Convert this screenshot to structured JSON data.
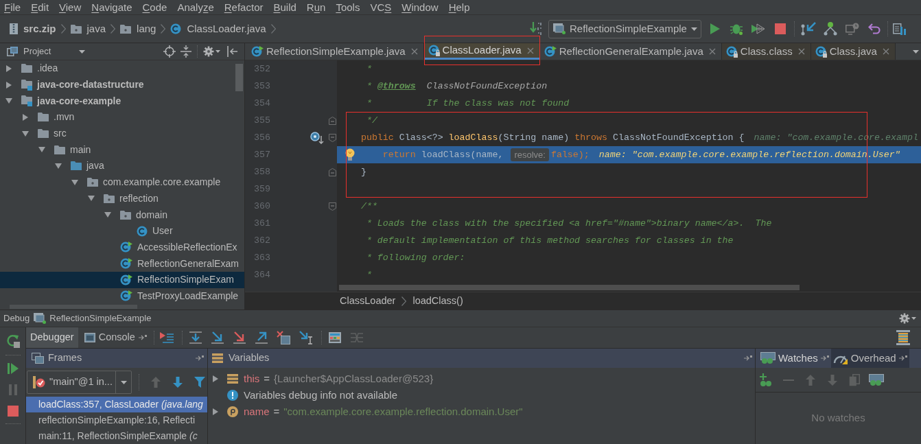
{
  "menu_bar": [
    {
      "key": "F",
      "post": "ile"
    },
    {
      "key": "E",
      "post": "dit"
    },
    {
      "key": "V",
      "post": "iew"
    },
    {
      "key": "N",
      "post": "avigate"
    },
    {
      "key": "C",
      "post": "ode"
    },
    {
      "pre": "Analy",
      "key": "z",
      "post": "e"
    },
    {
      "key": "R",
      "post": "efactor"
    },
    {
      "key": "B",
      "post": "uild"
    },
    {
      "pre": "R",
      "key": "u",
      "post": "n"
    },
    {
      "key": "T",
      "post": "ools"
    },
    {
      "pre": "VC",
      "key": "S"
    },
    {
      "key": "W",
      "post": "indow"
    },
    {
      "key": "H",
      "post": "elp"
    }
  ],
  "nav_bar": {
    "breadcrumbs": [
      {
        "label": "src.zip",
        "kind": "archive"
      },
      {
        "label": "java",
        "kind": "package"
      },
      {
        "label": "lang",
        "kind": "package"
      },
      {
        "label": "ClassLoader.java",
        "kind": "class"
      }
    ],
    "run_configuration": "ReflectionSimpleExample"
  },
  "project_panel": {
    "title": "Project",
    "tree": [
      {
        "label": ".idea",
        "kind": "folder",
        "expanded": false,
        "selected": false
      },
      {
        "label": "java-core-datastructure",
        "kind": "module",
        "expanded": false,
        "selected": false
      },
      {
        "label": "java-core-example",
        "kind": "module",
        "expanded": true,
        "selected": false,
        "children": [
          {
            "label": ".mvn",
            "kind": "folder",
            "expanded": false,
            "selected": false
          },
          {
            "label": "src",
            "kind": "folder",
            "expanded": true,
            "selected": false,
            "children": [
              {
                "label": "main",
                "kind": "folder",
                "expanded": true,
                "selected": false,
                "children": [
                  {
                    "label": "java",
                    "kind": "source-folder",
                    "expanded": true,
                    "selected": false,
                    "children": [
                      {
                        "label": "com.example.core.example",
                        "kind": "package",
                        "expanded": true,
                        "selected": false,
                        "children": [
                          {
                            "label": "reflection",
                            "kind": "package",
                            "expanded": true,
                            "selected": false,
                            "children": [
                              {
                                "label": "domain",
                                "kind": "package",
                                "expanded": true,
                                "selected": false,
                                "children": [
                                  {
                                    "label": "User",
                                    "kind": "class",
                                    "selected": false
                                  }
                                ]
                              },
                              {
                                "label": "AccessibleReflectionEx",
                                "kind": "runnable",
                                "selected": false
                              },
                              {
                                "label": "ReflectionGeneralExam",
                                "kind": "runnable",
                                "selected": false
                              },
                              {
                                "label": "ReflectionSimpleExam",
                                "kind": "runnable",
                                "selected": true
                              },
                              {
                                "label": "TestProxyLoadExample",
                                "kind": "runnable",
                                "selected": false
                              }
                            ]
                          }
                        ]
                      }
                    ]
                  }
                ]
              }
            ]
          }
        ]
      }
    ]
  },
  "editor": {
    "tabs": [
      {
        "label": "ReflectionSimpleExample.java",
        "kind": "runnable",
        "selected": false,
        "boxed": false
      },
      {
        "label": "ClassLoader.java",
        "kind": "library",
        "selected": true,
        "boxed": true
      },
      {
        "label": "ReflectionGeneralExample.java",
        "kind": "runnable",
        "selected": false,
        "boxed": false
      },
      {
        "label": "Class.class",
        "kind": "library",
        "selected": false,
        "boxed": false
      },
      {
        "label": "Class.java",
        "kind": "library",
        "selected": false,
        "boxed": false
      }
    ],
    "lines": [
      {
        "number": "352",
        "current": false,
        "boxed": false,
        "tokens": [
          {
            "text": "     *",
            "kind": "comment"
          }
        ]
      },
      {
        "number": "353",
        "current": false,
        "boxed": false,
        "tokens": [
          {
            "text": "     * ",
            "kind": "comment"
          },
          {
            "text": "@throws",
            "kind": "doc-tag"
          },
          {
            "text": "  ClassNotFoundException",
            "kind": "doc-value"
          }
        ]
      },
      {
        "number": "354",
        "current": false,
        "boxed": false,
        "tokens": [
          {
            "text": "     *          If the class was not found",
            "kind": "comment"
          }
        ]
      },
      {
        "number": "355",
        "current": false,
        "boxed": true,
        "markers": [
          {
            "kind": "fold-end"
          }
        ],
        "tokens": [
          {
            "text": "     */",
            "kind": "comment"
          }
        ]
      },
      {
        "number": "356",
        "current": false,
        "boxed": true,
        "markers": [
          {
            "kind": "overridden"
          },
          {
            "kind": "fold-start"
          }
        ],
        "tokens": [
          {
            "text": "    public",
            "kind": "keyword"
          },
          {
            "text": " Class<?> ",
            "kind": "plain"
          },
          {
            "text": "loadClass",
            "kind": "method"
          },
          {
            "text": "(String name) ",
            "kind": "plain"
          },
          {
            "text": "throws",
            "kind": "keyword"
          },
          {
            "text": " ClassNotFoundException {",
            "kind": "plain"
          },
          {
            "text": "name: \"com.example.core.exampl",
            "kind": "inline-value"
          }
        ]
      },
      {
        "number": "357",
        "current": true,
        "boxed": true,
        "markers": [
          {
            "kind": "bulb"
          }
        ],
        "tokens": [
          {
            "text": "        return",
            "kind": "keyword"
          },
          {
            "text": " loadClass(name, ",
            "kind": "plain"
          },
          {
            "text": "resolve:",
            "kind": "param-hint"
          },
          {
            "text": "false",
            "kind": "keyword"
          },
          {
            "text": ");",
            "kind": "keyword"
          },
          {
            "text": "name: \"com.example.core.example.reflection.domain.User\"",
            "kind": "inline-value"
          }
        ]
      },
      {
        "number": "358",
        "current": false,
        "boxed": true,
        "markers": [
          {
            "kind": "fold-end"
          }
        ],
        "tokens": [
          {
            "text": "    }",
            "kind": "plain"
          }
        ]
      },
      {
        "number": "359",
        "current": false,
        "boxed": true
      },
      {
        "number": "360",
        "current": false,
        "boxed": false,
        "markers": [
          {
            "kind": "fold-start"
          }
        ],
        "tokens": [
          {
            "text": "    /**",
            "kind": "comment"
          }
        ]
      },
      {
        "number": "361",
        "current": false,
        "boxed": false,
        "tokens": [
          {
            "text": "     * Loads the class with the specified <a href=\"#name\">binary name</a>.  The",
            "kind": "comment"
          }
        ]
      },
      {
        "number": "362",
        "current": false,
        "boxed": false,
        "tokens": [
          {
            "text": "     * default implementation of this method searches for classes in the",
            "kind": "comment"
          }
        ]
      },
      {
        "number": "363",
        "current": false,
        "boxed": false,
        "tokens": [
          {
            "text": "     * following order:",
            "kind": "comment"
          }
        ]
      },
      {
        "number": "364",
        "current": false,
        "boxed": false,
        "tokens": [
          {
            "text": "     *",
            "kind": "comment"
          }
        ]
      }
    ],
    "breadcrumbs": [
      "ClassLoader",
      "loadClass()"
    ]
  },
  "debug_window": {
    "title": "Debug",
    "session": "ReflectionSimpleExample",
    "tabs": [
      {
        "label": "Debugger",
        "selected": true
      },
      {
        "label": "Console",
        "selected": false
      }
    ],
    "frames": {
      "title": "Frames",
      "thread": "\"main\"@1 in...",
      "items": [
        {
          "location": "loadClass:357, ClassLoader",
          "package": "(java.lang",
          "selected": true
        },
        {
          "location": "reflectionSimpleExample:16, Reflecti",
          "selected": false
        },
        {
          "location": "main:11, ReflectionSimpleExample",
          "package": "(c",
          "selected": false
        }
      ]
    },
    "variables": {
      "title": "Variables",
      "items": [
        {
          "kind": "object",
          "name": "this",
          "operator": "=",
          "value": "{Launcher$AppClassLoader@523}",
          "expanded": false
        },
        {
          "kind": "info",
          "text": "Variables debug info not available"
        },
        {
          "kind": "parameter",
          "name": "name",
          "operator": "=",
          "value": "\"com.example.core.example.reflection.domain.User\"",
          "expanded": false
        }
      ]
    },
    "watches": {
      "tabs": [
        {
          "label": "Watches",
          "selected": true
        },
        {
          "label": "Overhead",
          "selected": false
        }
      ],
      "empty_text": "No watches"
    }
  }
}
